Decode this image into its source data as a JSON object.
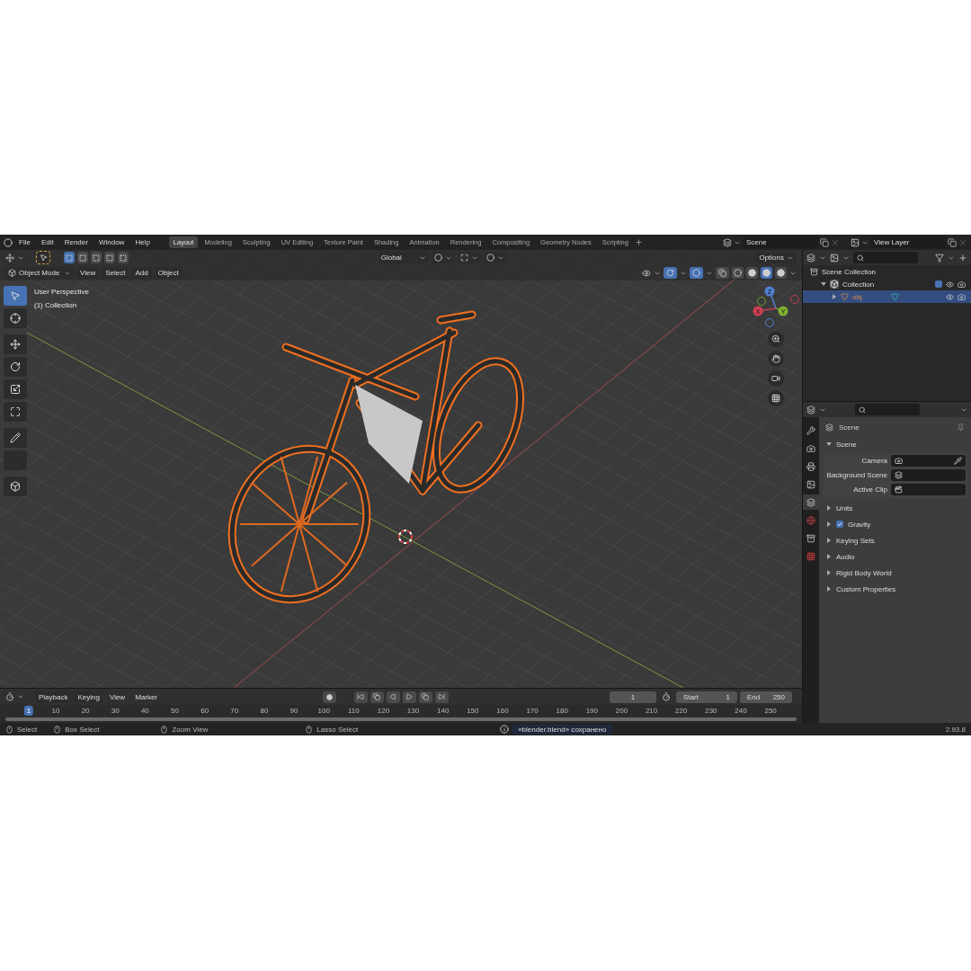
{
  "topbar": {
    "menus": [
      "File",
      "Edit",
      "Render",
      "Window",
      "Help"
    ],
    "workspaces": [
      {
        "label": "Layout",
        "selected": true
      },
      {
        "label": "Modeling",
        "selected": false
      },
      {
        "label": "Sculpting",
        "selected": false
      },
      {
        "label": "UV Editing",
        "selected": false
      },
      {
        "label": "Texture Paint",
        "selected": false
      },
      {
        "label": "Shading",
        "selected": false
      },
      {
        "label": "Animation",
        "selected": false
      },
      {
        "label": "Rendering",
        "selected": false
      },
      {
        "label": "Compositing",
        "selected": false
      },
      {
        "label": "Geometry Nodes",
        "selected": false
      },
      {
        "label": "Scripting",
        "selected": false
      }
    ],
    "scene": "Scene",
    "view_layer": "View Layer"
  },
  "viewport": {
    "select_modes": [
      {
        "selected": true
      },
      {
        "selected": false
      },
      {
        "selected": false
      },
      {
        "selected": false
      },
      {
        "selected": false
      }
    ],
    "orientation": "Global",
    "options": "Options",
    "mode": "Object Mode",
    "menus": [
      "View",
      "Select",
      "Add",
      "Object"
    ],
    "shading": [
      {
        "selected": false
      },
      {
        "selected": false
      },
      {
        "selected": true
      },
      {
        "selected": false
      }
    ],
    "overlay_text": [
      "User Perspective",
      "(1) Collection"
    ],
    "tools": [
      {
        "kind": "select_box",
        "selected": true
      },
      {
        "kind": "cursor",
        "selected": false
      },
      {
        "kind": "move",
        "selected": false
      },
      {
        "kind": "rotate",
        "selected": false
      },
      {
        "kind": "scale",
        "selected": false
      },
      {
        "kind": "transform",
        "selected": false
      },
      {
        "kind": "annotate",
        "selected": false
      },
      {
        "kind": "measure",
        "selected": false
      },
      {
        "kind": "add_cube",
        "selected": false
      }
    ],
    "gizmo": {
      "z": "Z",
      "y": "Y",
      "x": "X"
    }
  },
  "outliner": {
    "tree": [
      {
        "label": "Scene Collection",
        "kind": "scene",
        "selected": false,
        "children": [
          {
            "label": "Collection",
            "kind": "collection",
            "selected": false,
            "expanded": true,
            "checked": true,
            "children": [
              {
                "label": "obj",
                "kind": "object",
                "selected": true,
                "expanded": false
              }
            ]
          }
        ]
      }
    ]
  },
  "properties": {
    "tabs": [
      {
        "kind": "tool",
        "selected": false
      },
      {
        "kind": "render",
        "selected": false
      },
      {
        "kind": "output",
        "selected": false
      },
      {
        "kind": "view_layer",
        "selected": false
      },
      {
        "kind": "scene",
        "selected": true
      },
      {
        "kind": "world",
        "selected": false
      },
      {
        "kind": "collection",
        "selected": false
      },
      {
        "kind": "texture",
        "selected": false
      }
    ],
    "context": "Scene",
    "panel": {
      "title": "Scene",
      "expanded": true,
      "fields": [
        {
          "label": "Camera",
          "kind": "camera"
        },
        {
          "label": "Background Scene",
          "kind": "scene"
        },
        {
          "label": "Active Clip",
          "kind": "clip"
        }
      ]
    },
    "subpanels": [
      {
        "label": "Units",
        "kind": "plain",
        "expanded": false
      },
      {
        "label": "Gravity",
        "kind": "checkbox",
        "checked": true,
        "expanded": false
      },
      {
        "label": "Keying Sets",
        "kind": "plain",
        "expanded": false
      },
      {
        "label": "Audio",
        "kind": "plain",
        "expanded": false
      },
      {
        "label": "Rigid Body World",
        "kind": "plain",
        "expanded": false
      },
      {
        "label": "Custom Properties",
        "kind": "plain",
        "expanded": false
      }
    ]
  },
  "timeline": {
    "menus": [
      "Playback",
      "Keying",
      "View",
      "Marker"
    ],
    "current_frame": "1",
    "start_label": "Start",
    "start": "1",
    "end_label": "End",
    "end": "250",
    "ruler": [
      {
        "label": "1",
        "selected": true
      },
      {
        "label": "10",
        "selected": false
      },
      {
        "label": "20",
        "selected": false
      },
      {
        "label": "30",
        "selected": false
      },
      {
        "label": "40",
        "selected": false
      },
      {
        "label": "50",
        "selected": false
      },
      {
        "label": "60",
        "selected": false
      },
      {
        "label": "70",
        "selected": false
      },
      {
        "label": "80",
        "selected": false
      },
      {
        "label": "90",
        "selected": false
      },
      {
        "label": "100",
        "selected": false
      },
      {
        "label": "110",
        "selected": false
      },
      {
        "label": "120",
        "selected": false
      },
      {
        "label": "130",
        "selected": false
      },
      {
        "label": "140",
        "selected": false
      },
      {
        "label": "150",
        "selected": false
      },
      {
        "label": "160",
        "selected": false
      },
      {
        "label": "170",
        "selected": false
      },
      {
        "label": "180",
        "selected": false
      },
      {
        "label": "190",
        "selected": false
      },
      {
        "label": "200",
        "selected": false
      },
      {
        "label": "210",
        "selected": false
      },
      {
        "label": "220",
        "selected": false
      },
      {
        "label": "230",
        "selected": false
      },
      {
        "label": "240",
        "selected": false
      },
      {
        "label": "250",
        "selected": false
      }
    ]
  },
  "status_bar": {
    "hints": [
      "Select",
      "Box Select",
      "Zoom View",
      "Lasso Select"
    ],
    "message": "«blender.blend» сохранено",
    "version": "2.93.8"
  }
}
